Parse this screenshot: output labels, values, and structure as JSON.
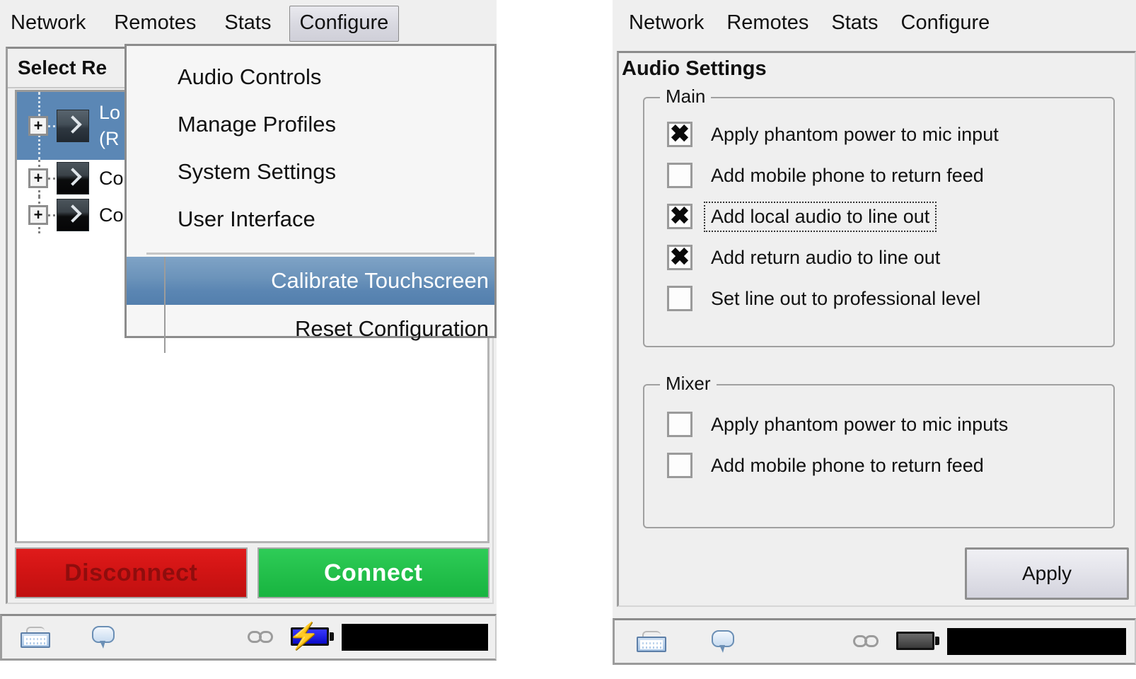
{
  "left_window": {
    "menubar": [
      {
        "label": "Network",
        "active": false
      },
      {
        "label": "Remotes",
        "active": false
      },
      {
        "label": "Stats",
        "active": false
      },
      {
        "label": "Configure",
        "active": true
      }
    ],
    "panel_header": "Select Re",
    "tree_items": [
      {
        "label_line1": "Lo",
        "label_line2": "(R",
        "selected": true
      },
      {
        "label_line1": "Co",
        "label_line2": "",
        "selected": false
      },
      {
        "label_line1": "Co",
        "label_line2": "",
        "selected": false
      }
    ],
    "buttons": {
      "disconnect": "Disconnect",
      "connect": "Connect"
    },
    "dropdown": {
      "open_for": "Configure",
      "top_items": [
        "Audio Controls",
        "Manage Profiles",
        "System Settings",
        "User Interface"
      ],
      "bottom_items": [
        {
          "label": "Calibrate Touchscreen",
          "highlighted": true
        },
        {
          "label": "Reset Configuration",
          "highlighted": false
        }
      ]
    },
    "statusbar": {
      "keyboard_icon": "keyboard-icon",
      "bubble_icon": "speech-bubble-icon",
      "link_icon": "link-icon",
      "battery_icon": "battery-charging-icon",
      "battery_fill_color": "#1414e6",
      "battery_charging": true
    }
  },
  "right_window": {
    "menubar": [
      {
        "label": "Network",
        "active": false
      },
      {
        "label": "Remotes",
        "active": false
      },
      {
        "label": "Stats",
        "active": false
      },
      {
        "label": "Configure",
        "active": false
      }
    ],
    "title": "Audio Settings",
    "groups": [
      {
        "legend": "Main",
        "options": [
          {
            "label": "Apply phantom power to mic input",
            "checked": true,
            "focused": false
          },
          {
            "label": "Add mobile phone to return feed",
            "checked": false,
            "focused": false
          },
          {
            "label": "Add local audio to line out",
            "checked": true,
            "focused": true
          },
          {
            "label": "Add return audio to line out",
            "checked": true,
            "focused": false
          },
          {
            "label": "Set line out to professional level",
            "checked": false,
            "focused": false
          }
        ]
      },
      {
        "legend": "Mixer",
        "options": [
          {
            "label": "Apply phantom power to mic inputs",
            "checked": false,
            "focused": false
          },
          {
            "label": "Add mobile phone to return feed",
            "checked": false,
            "focused": false
          }
        ]
      }
    ],
    "apply_button": "Apply",
    "statusbar": {
      "keyboard_icon": "keyboard-icon",
      "bubble_icon": "speech-bubble-icon",
      "link_icon": "link-icon",
      "battery_icon": "battery-icon",
      "battery_fill_color": "#4a4a4a",
      "battery_charging": false
    }
  },
  "checkbox_mark": "✖"
}
